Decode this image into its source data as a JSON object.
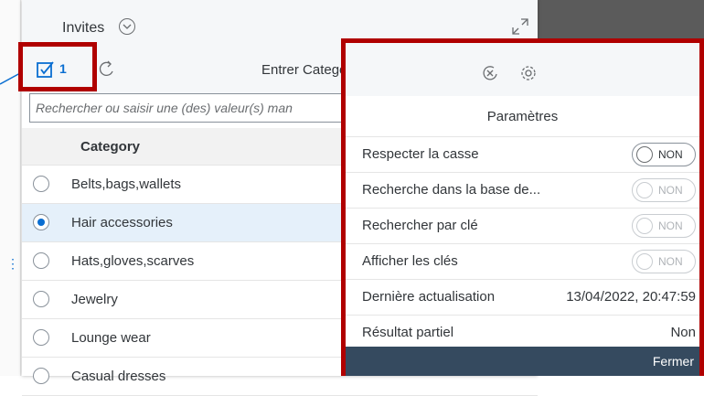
{
  "header": {
    "title": "Invites"
  },
  "toolbar": {
    "selected_count": "1",
    "title": "Entrer Categor"
  },
  "search": {
    "placeholder": "Rechercher ou saisir une (des) valeur(s) man"
  },
  "list": {
    "column_header": "Category",
    "rows": [
      {
        "label": "Belts,bags,wallets",
        "selected": false
      },
      {
        "label": "Hair accessories",
        "selected": true
      },
      {
        "label": "Hats,gloves,scarves",
        "selected": false
      },
      {
        "label": "Jewelry",
        "selected": false
      },
      {
        "label": "Lounge wear",
        "selected": false
      },
      {
        "label": "Casual dresses",
        "selected": false
      }
    ]
  },
  "settings": {
    "title": "Paramètres",
    "rows": [
      {
        "label": "Respecter la casse",
        "toggle": "NON",
        "enabled": true
      },
      {
        "label": "Recherche dans la base de...",
        "toggle": "NON",
        "enabled": false
      },
      {
        "label": "Rechercher par clé",
        "toggle": "NON",
        "enabled": false
      },
      {
        "label": "Afficher les clés",
        "toggle": "NON",
        "enabled": false
      }
    ],
    "last_refresh_label": "Dernière actualisation",
    "last_refresh_value": "13/04/2022, 20:47:59",
    "partial_label": "Résultat partiel",
    "partial_value": "Non",
    "close_label": "Fermer"
  },
  "colors": {
    "accent": "#0a6ed1",
    "highlight": "#b00000",
    "footer": "#354a5f"
  }
}
